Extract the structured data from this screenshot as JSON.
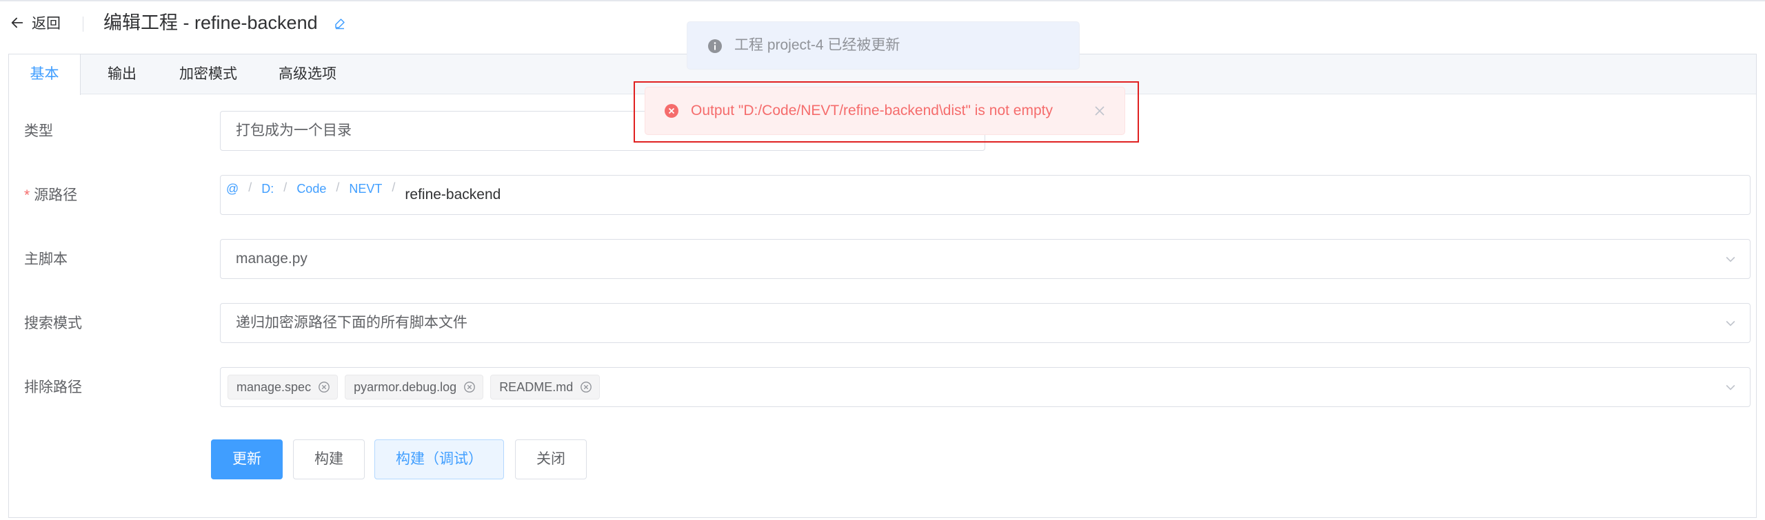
{
  "header": {
    "back_label": "返回",
    "title": "编辑工程 - refine-backend"
  },
  "tabs": [
    {
      "label": "基本",
      "active": true
    },
    {
      "label": "输出",
      "active": false
    },
    {
      "label": "加密模式",
      "active": false
    },
    {
      "label": "高级选项",
      "active": false
    }
  ],
  "form": {
    "type": {
      "label": "类型",
      "value": "打包成为一个目录"
    },
    "source_path": {
      "label": "源路径",
      "required_mark": "*",
      "crumbs": [
        "@",
        "D:",
        "Code",
        "NEVT"
      ],
      "separator": "/",
      "current": "refine-backend"
    },
    "main_script": {
      "label": "主脚本",
      "value": "manage.py"
    },
    "search_mode": {
      "label": "搜索模式",
      "value": "递归加密源路径下面的所有脚本文件"
    },
    "exclude_paths": {
      "label": "排除路径",
      "tags": [
        "manage.spec",
        "pyarmor.debug.log",
        "README.md"
      ]
    }
  },
  "buttons": {
    "update": "更新",
    "build": "构建",
    "build_debug": "构建（调试）",
    "close": "关闭"
  },
  "messages": {
    "info": "工程 project-4 已经被更新",
    "error": "Output \"D:/Code/NEVT/refine-backend\\dist\" is not empty"
  },
  "colors": {
    "primary": "#409eff",
    "error": "#f56c6c",
    "info_bg": "#edf2fc",
    "error_bg": "#fef0f0",
    "highlight_box": "#e02020"
  }
}
